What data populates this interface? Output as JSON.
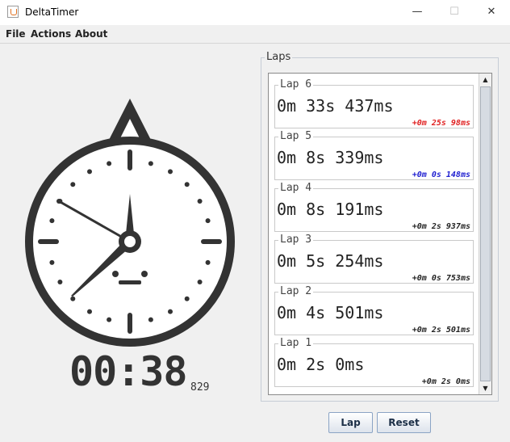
{
  "window": {
    "title": "DeltaTimer",
    "controls": {
      "minimize": "—",
      "maximize": "☐",
      "close": "✕"
    }
  },
  "menu": [
    "File",
    "Actions",
    "About"
  ],
  "stopwatch": {
    "main_time": "00:38",
    "millis": "829"
  },
  "laps_panel": {
    "title": "Laps",
    "laps": [
      {
        "title": "Lap 6",
        "time": "0m 33s 437ms",
        "delta": "+0m 25s 98ms",
        "delta_color": "#e02020"
      },
      {
        "title": "Lap 5",
        "time": "0m 8s 339ms",
        "delta": "+0m 0s 148ms",
        "delta_color": "#2020d0"
      },
      {
        "title": "Lap 4",
        "time": "0m 8s 191ms",
        "delta": "+0m 2s 937ms",
        "delta_color": "#222222"
      },
      {
        "title": "Lap 3",
        "time": "0m 5s 254ms",
        "delta": "+0m 0s 753ms",
        "delta_color": "#222222"
      },
      {
        "title": "Lap 2",
        "time": "0m 4s 501ms",
        "delta": "+0m 2s 501ms",
        "delta_color": "#222222"
      },
      {
        "title": "Lap 1",
        "time": "0m 2s 0ms",
        "delta": "+0m 2s 0ms",
        "delta_color": "#222222"
      }
    ]
  },
  "buttons": {
    "lap": "Lap",
    "reset": "Reset"
  },
  "colors": {
    "clock_ink": "#333333"
  }
}
